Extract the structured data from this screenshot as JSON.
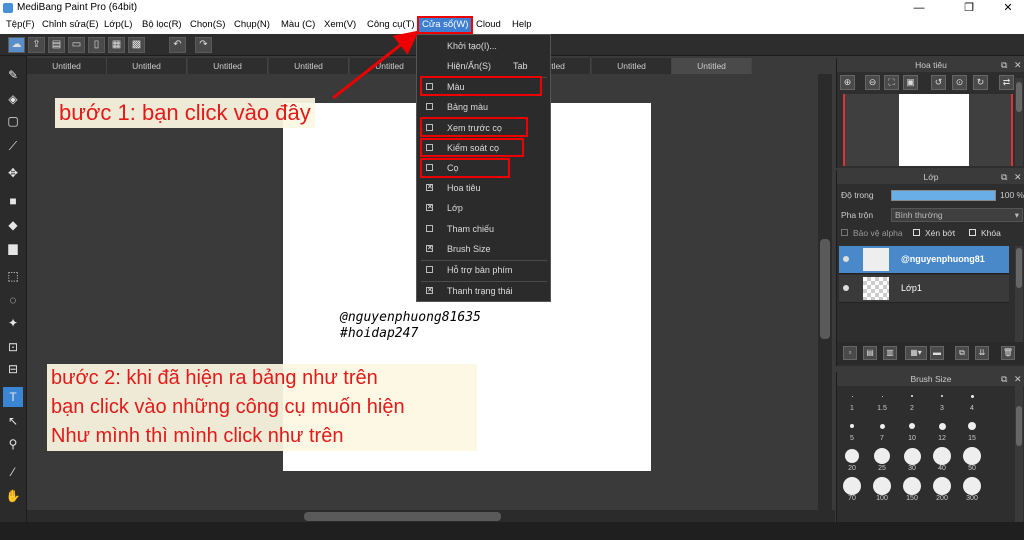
{
  "window": {
    "title": "MediBang Paint Pro (64bit)",
    "minimize": "—",
    "maximize": "❐",
    "close": "✕"
  },
  "menu": [
    "Tệp(F)",
    "Chỉnh sửa(E)",
    "Lớp(L)",
    "Bộ lọc(R)",
    "Chọn(S)",
    "Chụp(N)",
    "Màu (C)",
    "Xem(V)",
    "Công cụ(T)",
    "Cửa sổ(W)",
    "Cloud",
    "Help"
  ],
  "toolbar": {
    "undo": "↶",
    "redo": "↷"
  },
  "tabs": [
    "Untitled",
    "Untitled",
    "Untitled",
    "Untitled",
    "Untitled",
    "Untitled",
    "Untitled",
    "Untitled",
    "Untitled"
  ],
  "canvas": {
    "handwriting_line1": "@nguyenphuong81635",
    "handwriting_line2": "#hoidap247"
  },
  "annotations": {
    "step1": "bước 1: bạn click vào đây",
    "step2_lines": [
      "bước 2: khi đã hiện ra bảng như trên",
      "bạn click vào những công cụ muốn hiện",
      "Như mình thì mình click như trên"
    ]
  },
  "window_menu": {
    "items": [
      {
        "label": "Khởi tạo(I)...",
        "check": null,
        "shortcut": ""
      },
      {
        "label": "Hiện/Ẩn(S)",
        "check": null,
        "shortcut": "Tab"
      },
      {
        "label": "Màu",
        "check": false,
        "shortcut": ""
      },
      {
        "label": "Bảng màu",
        "check": false,
        "shortcut": ""
      },
      {
        "label": "Xem trước cọ",
        "check": false,
        "shortcut": ""
      },
      {
        "label": "Kiểm soát cọ",
        "check": false,
        "shortcut": ""
      },
      {
        "label": "Cọ",
        "check": false,
        "shortcut": ""
      },
      {
        "label": "Hoa tiêu",
        "check": true,
        "shortcut": ""
      },
      {
        "label": "Lớp",
        "check": true,
        "shortcut": ""
      },
      {
        "label": "Tham chiếu",
        "check": false,
        "shortcut": ""
      },
      {
        "label": "Brush Size",
        "check": true,
        "shortcut": ""
      },
      {
        "label": "Hỗ trợ bàn phím",
        "check": false,
        "shortcut": ""
      },
      {
        "label": "Thanh trạng thái",
        "check": true,
        "shortcut": ""
      }
    ]
  },
  "navigator": {
    "title": "Hoa tiêu"
  },
  "layers": {
    "title": "Lớp",
    "opacity_label": "Độ trong",
    "opacity_value": "100 %",
    "opacity_fraction": 1.0,
    "blend_label": "Pha trộn",
    "blend_value": "Bình thường",
    "protect_alpha": "Bảo vệ alpha",
    "clipping": "Xén bớt",
    "lock": "Khóa",
    "items": [
      {
        "name": "@nguyenphuong81",
        "selected": true
      },
      {
        "name": "Lớp1",
        "selected": false
      }
    ]
  },
  "brush_size": {
    "title": "Brush Size",
    "sizes": [
      "1",
      "1.5",
      "2",
      "3",
      "4",
      "5",
      "7",
      "10",
      "12",
      "15",
      "20",
      "25",
      "30",
      "40",
      "50",
      "70",
      "100",
      "150",
      "200",
      "300"
    ]
  },
  "colors": {
    "accent": "#3a86d4",
    "annotation_red": "#e11a1a",
    "highlight_box": "#e00000"
  }
}
